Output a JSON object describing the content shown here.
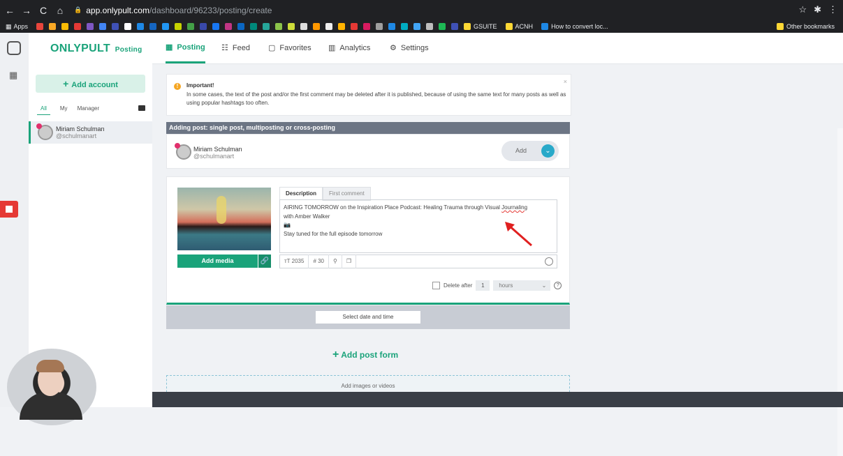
{
  "browser": {
    "url_host": "app.onlypult.com",
    "url_path": "/dashboard/96233/posting/create",
    "bookmarks": [
      "Apps",
      "GSUITE",
      "ACNH",
      "How to convert loc...",
      "Other bookmarks"
    ]
  },
  "brand": {
    "name": "ONLYPULT",
    "sub": "Posting"
  },
  "sidebar": {
    "add_account": "Add account",
    "filters": [
      "All",
      "My",
      "Manager"
    ],
    "account": {
      "name": "Miriam Schulman",
      "handle": "@schulmanart"
    }
  },
  "nav": {
    "tabs": [
      {
        "label": "Posting",
        "icon": "calendar-icon"
      },
      {
        "label": "Feed",
        "icon": "grid-icon"
      },
      {
        "label": "Favorites",
        "icon": "bookmark-icon"
      },
      {
        "label": "Analytics",
        "icon": "chart-icon"
      },
      {
        "label": "Settings",
        "icon": "gear-icon"
      }
    ]
  },
  "notice": {
    "title": "Important!",
    "text": "In some cases, the text of the post and/or the first comment may be deleted after it is published, because of using the same text for many posts as well as using popular hashtags too often."
  },
  "post": {
    "header": "Adding post: single post, multiposting or cross-posting",
    "account_name": "Miriam Schulman",
    "account_handle": "@schulmanart",
    "add_label": "Add",
    "add_media": "Add media",
    "tab_description": "Description",
    "tab_comment": "First comment",
    "text_line1": "AIRING TOMORROW on the Inspiration Place Podcast: Healing Trauma through Visual ",
    "text_underlined": "Journaling",
    "text_line2": "with Amber Walker",
    "text_line3": "📷",
    "text_line4": "Stay tuned for the full episode tomorrow",
    "char_count": "2035",
    "hashtag_count": "30",
    "delete_after": "Delete after",
    "delete_value": "1",
    "delete_unit": "hours",
    "select_date": "Select date and time"
  },
  "add_post_form": "Add post form",
  "dropzone": "Add images or videos"
}
